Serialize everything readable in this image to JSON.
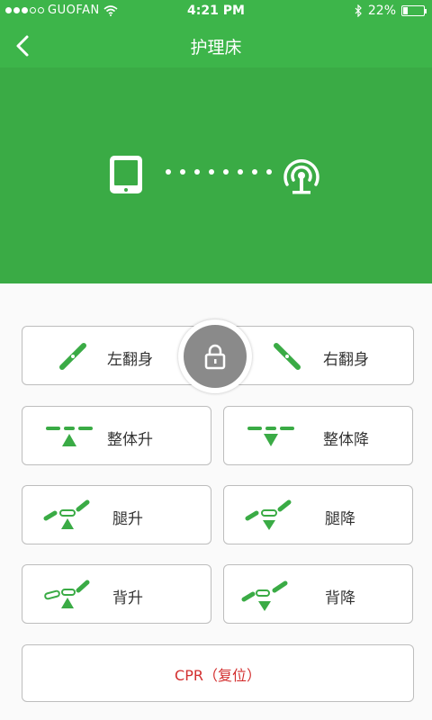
{
  "status": {
    "carrier": "GUOFAN",
    "time": "4:21 PM",
    "battery": "22%"
  },
  "nav": {
    "title": "护理床"
  },
  "colors": {
    "header": "#3db54a",
    "banner": "#3aab45",
    "accent": "#3aab45",
    "lock": "#8a8a8a",
    "cpr": "#d32f2f"
  },
  "controls": {
    "left_turn": "左翻身",
    "right_turn": "右翻身",
    "body_up": "整体升",
    "body_down": "整体降",
    "leg_up": "腿升",
    "leg_down": "腿降",
    "back_up": "背升",
    "back_down": "背降",
    "cpr": "CPR（复位）"
  },
  "icons": {
    "back": "chevron-left-icon",
    "device": "tablet-icon",
    "signal": "broadcast-antenna-icon",
    "lock": "lock-icon"
  }
}
